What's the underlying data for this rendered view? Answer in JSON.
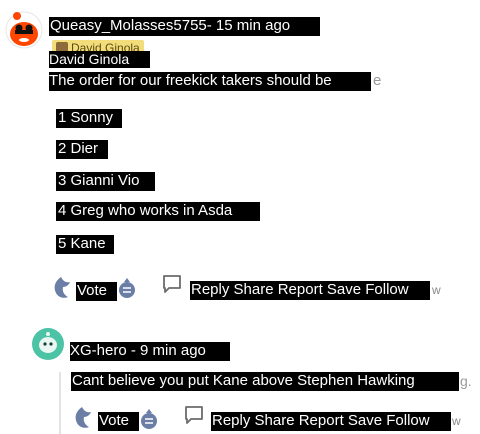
{
  "comment": {
    "author_line": "Queasy_Molasses5755- 15 min ago",
    "flair": "David Ginola",
    "display_name": "David Ginola",
    "intro": "The order for our freekick takers should be",
    "intro_trail": "e",
    "list": [
      {
        "text": "1 Sonny"
      },
      {
        "text": "2 Dier"
      },
      {
        "text": "3 Gianni Vio"
      },
      {
        "text": "4 Greg who works in Asda"
      },
      {
        "text": "5 Kane"
      }
    ],
    "actions": {
      "vote": "Vote",
      "buttons": "Reply Share Report Save Follow",
      "trail": "w"
    }
  },
  "reply": {
    "author_line": "XG-hero - 9 min ago",
    "text": "Cant believe you put Kane above Stephen Hawking",
    "text_trail": "g.",
    "actions": {
      "vote": "Vote",
      "buttons": "Reply Share Report Save Follow",
      "trail": "w"
    }
  },
  "colors": {
    "mask": "#000000",
    "flair_bg": "#f3dd7b",
    "avatar_op": "#ff4500",
    "avatar_reply": "#4cc3a5",
    "vote_icon": "#6b7fa6"
  }
}
